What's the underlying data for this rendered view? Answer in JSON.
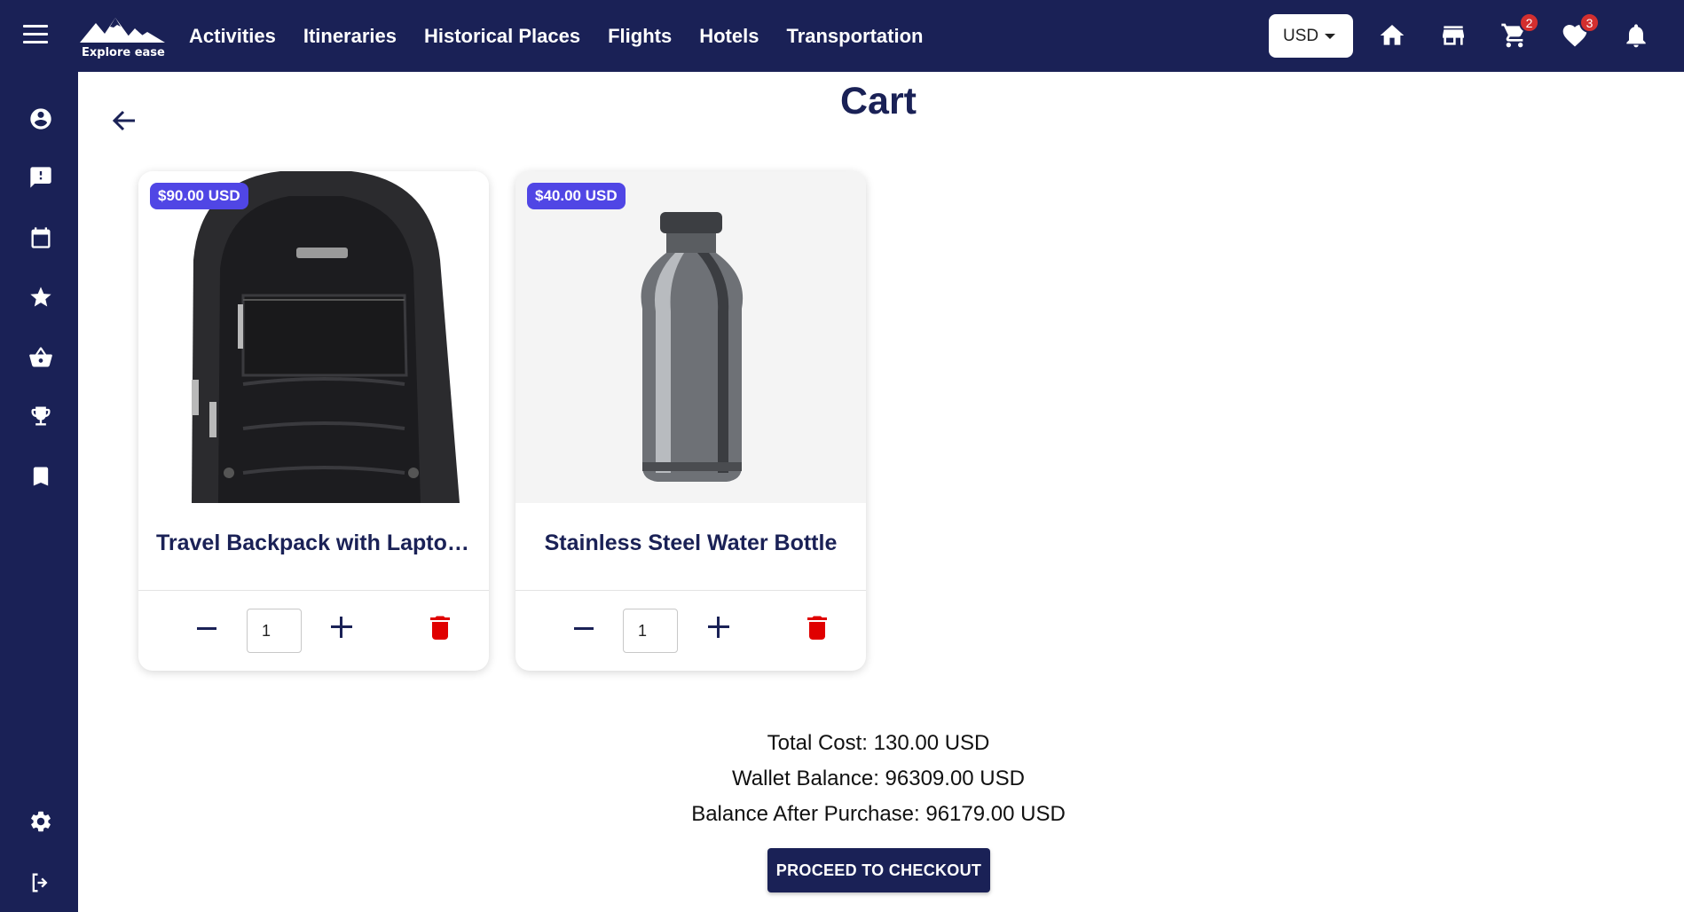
{
  "header": {
    "logo_text": "Explore ease",
    "nav": [
      "Activities",
      "Itineraries",
      "Historical Places",
      "Flights",
      "Hotels",
      "Transportation"
    ],
    "currency": "USD",
    "cart_badge": "2",
    "wishlist_badge": "3"
  },
  "page": {
    "title": "Cart"
  },
  "items": [
    {
      "price": "$90.00 USD",
      "name": "Travel Backpack with Laptop Compartment",
      "quantity": "1"
    },
    {
      "price": "$40.00 USD",
      "name": "Stainless Steel Water Bottle",
      "quantity": "1"
    }
  ],
  "summary": {
    "total": "Total Cost: 130.00 USD",
    "wallet": "Wallet Balance: 96309.00 USD",
    "after": "Balance After Purchase: 96179.00 USD"
  },
  "checkout_label": "PROCEED TO CHECKOUT",
  "colors": {
    "navy": "#1a2156",
    "price_badge": "#5046e5",
    "delete": "#e00000",
    "notification_badge": "#d32f2f"
  }
}
